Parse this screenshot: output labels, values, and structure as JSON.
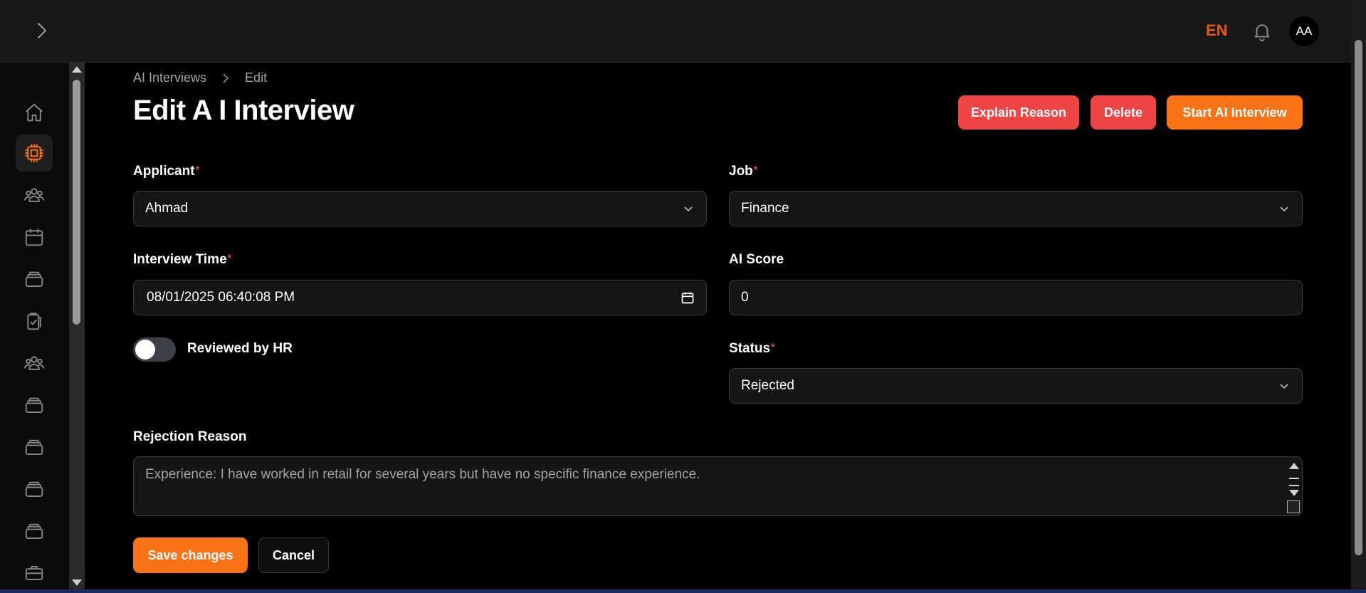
{
  "header": {
    "language": "EN",
    "avatar_initials": "AA"
  },
  "sidebar": {
    "items": [
      {
        "icon": "home-icon"
      },
      {
        "icon": "cpu-chip-icon",
        "active": true
      },
      {
        "icon": "users-group-icon"
      },
      {
        "icon": "calendar-icon"
      },
      {
        "icon": "stack-icon"
      },
      {
        "icon": "clipboard-check-icon"
      },
      {
        "icon": "users-group-icon"
      },
      {
        "icon": "stack-icon"
      },
      {
        "icon": "stack-icon"
      },
      {
        "icon": "stack-icon"
      },
      {
        "icon": "stack-icon"
      },
      {
        "icon": "briefcase-icon"
      }
    ]
  },
  "breadcrumb": {
    "parent": "AI Interviews",
    "current": "Edit"
  },
  "page": {
    "title": "Edit A I Interview"
  },
  "actions": {
    "explain_reason": "Explain Reason",
    "delete": "Delete",
    "start_interview": "Start AI Interview"
  },
  "form": {
    "applicant": {
      "label": "Applicant",
      "value": "Ahmad"
    },
    "job": {
      "label": "Job",
      "value": "Finance"
    },
    "interview_time": {
      "label": "Interview Time",
      "value": "08/01/2025 06:40:08 PM"
    },
    "ai_score": {
      "label": "AI Score",
      "value": "0"
    },
    "reviewed_by_hr": {
      "label": "Reviewed by HR",
      "checked": false
    },
    "status": {
      "label": "Status",
      "value": "Rejected"
    },
    "rejection_reason": {
      "label": "Rejection Reason",
      "value": "Experience: I have worked in retail for several years but have no specific finance experience."
    },
    "required_mark": "*",
    "save": "Save changes",
    "cancel": "Cancel"
  },
  "colors": {
    "accent": "#f97316",
    "danger": "#ef4444",
    "lang": "#ea580c"
  }
}
